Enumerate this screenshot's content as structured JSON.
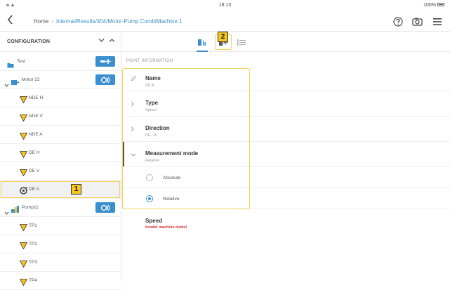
{
  "status_bar": {
    "time": "18:13",
    "battery": "100%"
  },
  "nav": {
    "back_icon": "chevron-left-icon",
    "home": "Home",
    "separator": "›",
    "path": "Internal/Results/404/Motor-Pump CombiMachine 1",
    "icons": [
      "help-icon",
      "camera-settings-icon",
      "menu-icon"
    ]
  },
  "sidebar": {
    "title": "CONFIGURATION",
    "collapse_icon": "chevron-down-icon",
    "expand_icon": "chevron-up-icon",
    "items": [
      {
        "label": "Test",
        "icon": "asset-folder-icon",
        "level": 0,
        "action": "add-point-icon"
      },
      {
        "label": "Motor 22",
        "icon": "motor-icon",
        "level": 0,
        "expandable": true,
        "action": "sensor-icon"
      },
      {
        "label": "NDE H",
        "icon": "warning-triangle-icon",
        "level": 1
      },
      {
        "label": "NDE V",
        "icon": "warning-triangle-icon",
        "level": 1
      },
      {
        "label": "NDE A",
        "icon": "warning-triangle-icon",
        "level": 1
      },
      {
        "label": "DE H",
        "icon": "warning-triangle-icon",
        "level": 1
      },
      {
        "label": "DE V",
        "icon": "warning-triangle-icon",
        "level": 1
      },
      {
        "label": "DE A",
        "icon": "point-ok-icon",
        "level": 1,
        "selected": true
      },
      {
        "label": "Pump11",
        "icon": "pump-icon",
        "level": 0,
        "expandable": true,
        "action": "sensor-icon"
      },
      {
        "label": "TP1",
        "icon": "warning-triangle-icon",
        "level": 1
      },
      {
        "label": "TP2",
        "icon": "warning-triangle-icon",
        "level": 1
      },
      {
        "label": "TP3",
        "icon": "warning-triangle-icon",
        "level": 1
      },
      {
        "label": "TP4",
        "icon": "warning-triangle-icon",
        "level": 1
      }
    ]
  },
  "markers": {
    "one": "1",
    "two": "2"
  },
  "tabs": [
    {
      "icon": "point-info-tab-icon",
      "active": true
    },
    {
      "icon": "measurement-setup-tab-icon",
      "active": false
    },
    {
      "icon": "list-tab-icon",
      "active": false
    }
  ],
  "point_info": {
    "section_title": "POINT INFORMATION",
    "name": {
      "label": "Name",
      "value": "DE A",
      "icon": "edit-pencil-icon"
    },
    "type": {
      "label": "Type",
      "value": "Speed",
      "icon": "chevron-right-icon"
    },
    "direction": {
      "label": "Direction",
      "value": "DE - A",
      "icon": "chevron-right-icon"
    },
    "measurement_mode": {
      "label": "Measurement mode",
      "value": "Relative",
      "icon": "chevron-down-icon",
      "options": [
        "Absolute",
        "Relative"
      ],
      "selected": "Relative"
    },
    "speed": {
      "label": "Speed",
      "value": "Invalid machine model"
    }
  },
  "colors": {
    "accent": "#3a8fd0",
    "highlight": "#f2d35a",
    "warning": "#f7c520",
    "error": "#d62f3a"
  }
}
